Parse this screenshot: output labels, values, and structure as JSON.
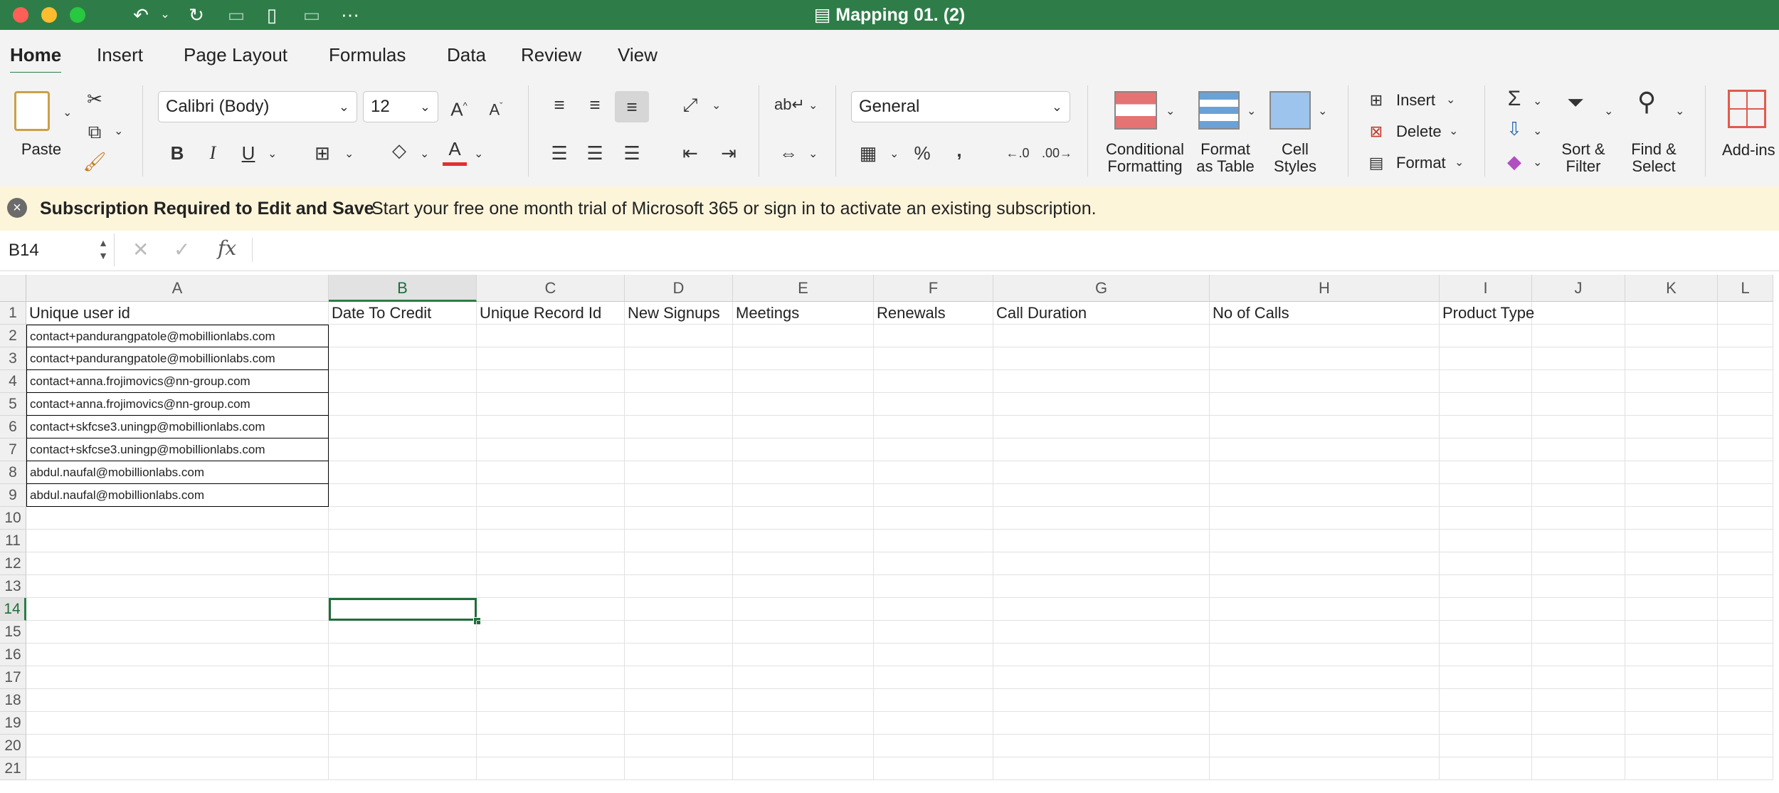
{
  "window": {
    "title": "Mapping 01. (2)"
  },
  "tabs": [
    "Home",
    "Insert",
    "Page Layout",
    "Formulas",
    "Data",
    "Review",
    "View"
  ],
  "ribbon": {
    "paste": "Paste",
    "font_name": "Calibri (Body)",
    "font_size": "12",
    "number_format": "General",
    "conditional_formatting": [
      "Conditional",
      "Formatting"
    ],
    "format_as_table": [
      "Format",
      "as Table"
    ],
    "cell_styles": [
      "Cell",
      "Styles"
    ],
    "insert": "Insert",
    "delete": "Delete",
    "format": "Format",
    "sort_filter": [
      "Sort &",
      "Filter"
    ],
    "find_select": [
      "Find &",
      "Select"
    ],
    "addins": "Add-ins",
    "bold": "B",
    "italic": "I",
    "underline": "U",
    "percent": "%",
    "comma": ","
  },
  "message": {
    "title": "Subscription Required to Edit and Save",
    "text": "Start your free one month trial of Microsoft 365 or sign in to activate an existing subscription."
  },
  "formula_bar": {
    "name_box": "B14",
    "fx": "fx",
    "formula": ""
  },
  "sheet": {
    "columns": [
      "A",
      "B",
      "C",
      "D",
      "E",
      "F",
      "G",
      "H",
      "I",
      "J",
      "K",
      "L"
    ],
    "rows": [
      "1",
      "2",
      "3",
      "4",
      "5",
      "6",
      "7",
      "8",
      "9",
      "10",
      "11",
      "12",
      "13",
      "14",
      "15",
      "16",
      "17",
      "18",
      "19",
      "20",
      "21"
    ],
    "headers": [
      "Unique user id",
      "Date To Credit",
      "Unique Record Id",
      "New Signups",
      "Meetings",
      "Renewals",
      "Call Duration",
      "No of Calls",
      "Product Type"
    ],
    "emails": [
      "contact+pandurangpatole@mobillionlabs.com",
      "contact+pandurangpatole@mobillionlabs.com",
      "contact+anna.frojimovics@nn-group.com",
      "contact+anna.frojimovics@nn-group.com",
      "contact+skfcse3.uningp@mobillionlabs.com",
      "contact+skfcse3.uningp@mobillionlabs.com",
      "abdul.naufal@mobillionlabs.com",
      "abdul.naufal@mobillionlabs.com"
    ],
    "selected_cell": "B14"
  }
}
